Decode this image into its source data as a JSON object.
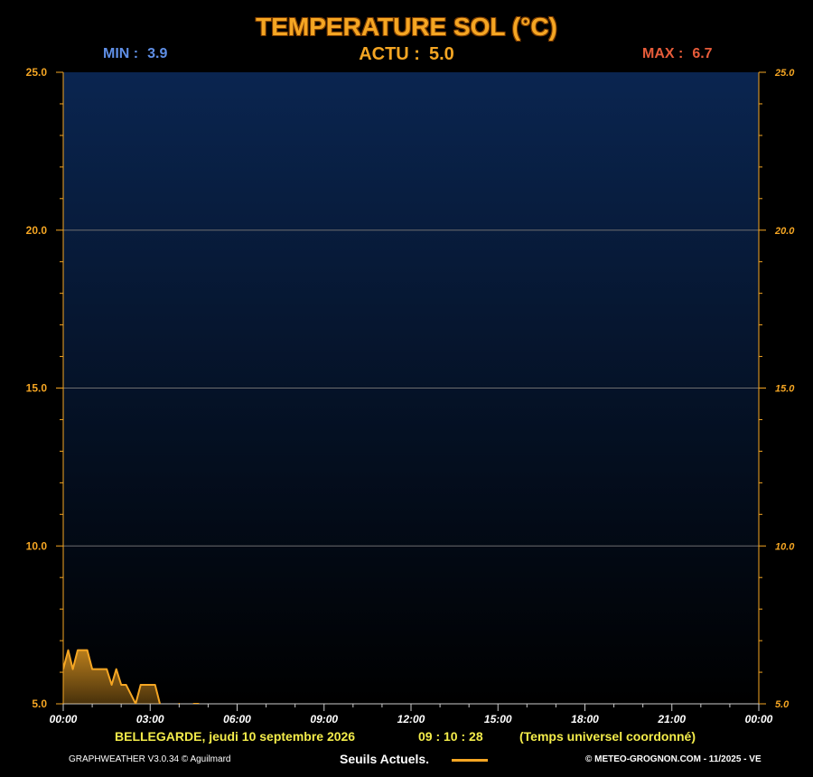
{
  "header": {
    "title": "TEMPERATURE SOL (°C)",
    "min_label": "MIN :",
    "min_value": "3.9",
    "actu_label": "ACTU :",
    "actu_value": "5.0",
    "max_label": "MAX :",
    "max_value": "6.7"
  },
  "footer": {
    "location_date": "BELLEGARDE,  jeudi 10 septembre 2026",
    "time": "09 : 10 : 28",
    "timezone": "(Temps universel coordonné)",
    "software": "GRAPHWEATHER V3.0.34 © Aguilmard",
    "legend_label": "Seuils Actuels.",
    "credit": "© METEO-GROGNON.COM - 11/2025 - VE"
  },
  "colors": {
    "title": "#f5a623",
    "min": "#5f8fe6",
    "max": "#e85c3a",
    "axis": "#f5a623",
    "line": "#f5a623",
    "footer_text": "#f3ec4a",
    "plot_top": "#0a2550",
    "plot_bottom": "#000000"
  },
  "chart_data": {
    "type": "area",
    "title": "TEMPERATURE SOL (°C)",
    "xlabel": "",
    "ylabel": "",
    "x_tick_labels": [
      "00:00",
      "03:00",
      "06:00",
      "09:00",
      "12:00",
      "15:00",
      "18:00",
      "21:00",
      "00:00"
    ],
    "y_tick_labels": [
      "5.0",
      "10.0",
      "15.0",
      "20.0",
      "25.0"
    ],
    "ylim": [
      5.0,
      25.0
    ],
    "xlim_hours": [
      0,
      24
    ],
    "grid": true,
    "series": [
      {
        "x": [
          0.0,
          0.17,
          0.33,
          0.5,
          0.83,
          1.0,
          1.17,
          1.5,
          1.67,
          1.83,
          2.0,
          2.17,
          2.5,
          2.67,
          2.83,
          3.0,
          3.17,
          3.5,
          3.67,
          3.83,
          4.0,
          4.17,
          4.33,
          4.5,
          4.67,
          4.83,
          5.0,
          5.17,
          5.33,
          5.5,
          5.67,
          5.83,
          6.0,
          6.17,
          6.33,
          6.5,
          6.67,
          6.83,
          7.0,
          7.17,
          7.33,
          7.5,
          7.67,
          7.83,
          8.0,
          8.17,
          8.33,
          8.5,
          8.67,
          8.83,
          9.0,
          9.17
        ],
        "y": [
          6.1,
          6.7,
          6.1,
          6.7,
          6.7,
          6.1,
          6.1,
          6.1,
          5.6,
          6.1,
          5.6,
          5.6,
          5.0,
          5.6,
          5.6,
          5.6,
          5.6,
          4.4,
          4.4,
          4.4,
          5.0,
          4.4,
          4.4,
          5.0,
          5.0,
          3.9,
          3.9,
          3.9,
          3.9,
          4.4,
          4.4,
          3.9,
          4.4,
          4.4,
          3.9,
          4.4,
          4.4,
          4.4,
          3.9,
          3.9,
          4.4,
          4.4,
          4.4,
          4.4,
          4.4,
          4.4,
          4.4,
          4.4,
          4.4,
          4.4,
          4.4,
          5.0
        ]
      }
    ]
  }
}
